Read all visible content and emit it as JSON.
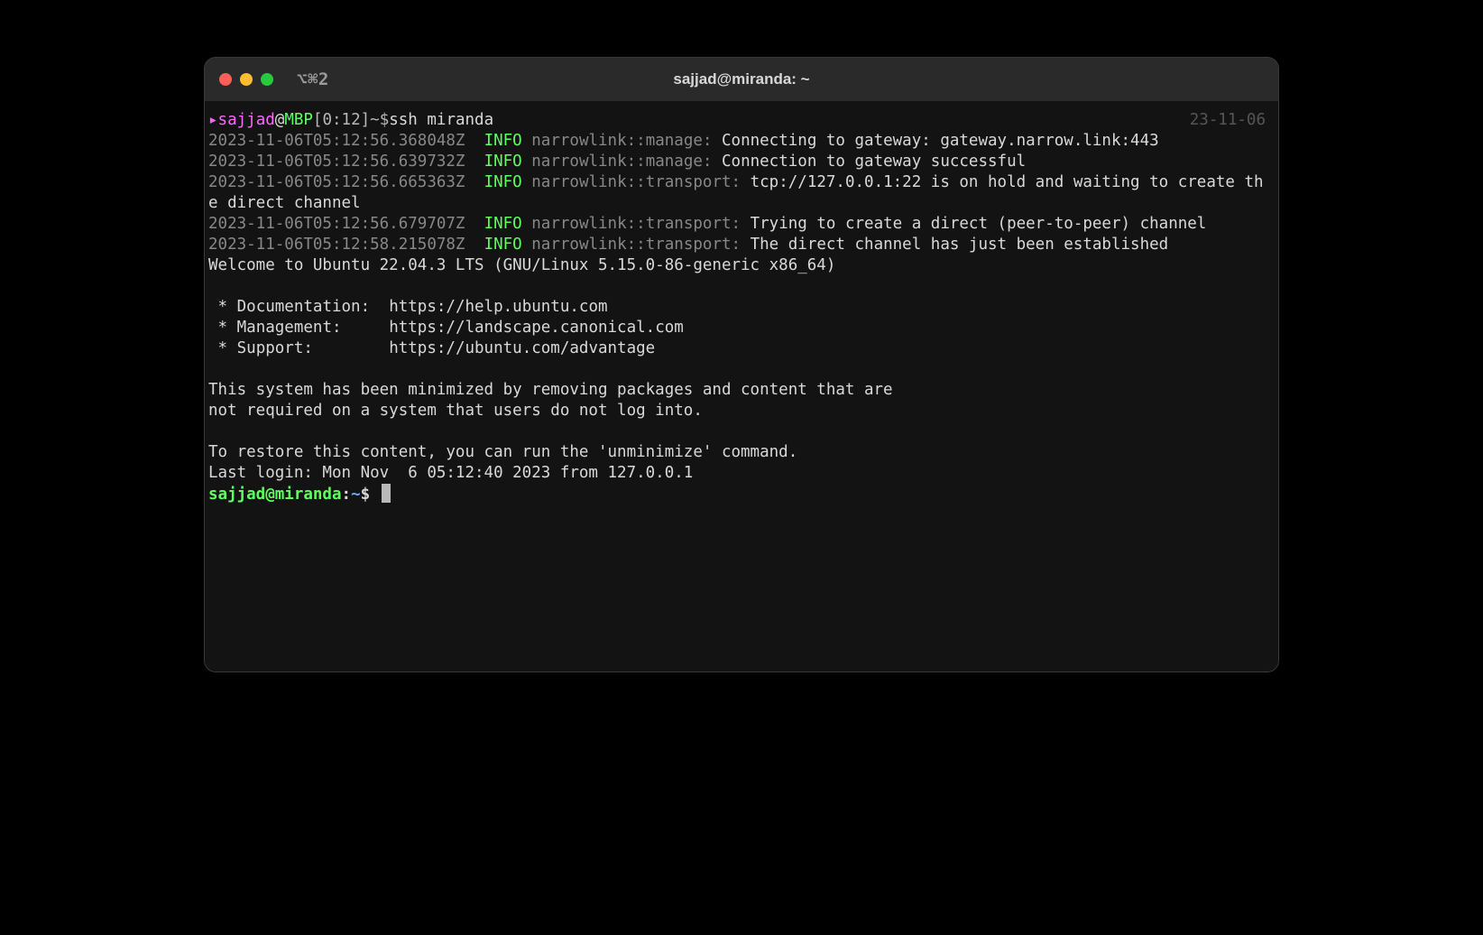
{
  "window": {
    "title": "sajjad@miranda: ~",
    "session_hint": "⌥⌘2"
  },
  "prompt1": {
    "caret": "▸",
    "user": "sajjad",
    "at": "@",
    "host": "MBP",
    "meta": "[0:12]",
    "path": "~",
    "dollar": "$",
    "command": "ssh miranda",
    "date_right": "23-11-06"
  },
  "logs": [
    {
      "ts": "2023-11-06T05:12:56.368048Z",
      "level": "INFO",
      "module": "narrowlink::manage:",
      "msg": "Connecting to gateway: gateway.narrow.link:443"
    },
    {
      "ts": "2023-11-06T05:12:56.639732Z",
      "level": "INFO",
      "module": "narrowlink::manage:",
      "msg": "Connection to gateway successful"
    },
    {
      "ts": "2023-11-06T05:12:56.665363Z",
      "level": "INFO",
      "module": "narrowlink::transport:",
      "msg": "tcp://127.0.0.1:22 is on hold and waiting to create the direct channel"
    },
    {
      "ts": "2023-11-06T05:12:56.679707Z",
      "level": "INFO",
      "module": "narrowlink::transport:",
      "msg": "Trying to create a direct (peer-to-peer) channel"
    },
    {
      "ts": "2023-11-06T05:12:58.215078Z",
      "level": "INFO",
      "module": "narrowlink::transport:",
      "msg": "The direct channel has just been established"
    }
  ],
  "motd": {
    "welcome": "Welcome to Ubuntu 22.04.3 LTS (GNU/Linux 5.15.0-86-generic x86_64)",
    "blank1": "",
    "doc": " * Documentation:  https://help.ubuntu.com",
    "mgmt": " * Management:     https://landscape.canonical.com",
    "support": " * Support:        https://ubuntu.com/advantage",
    "blank2": "",
    "min1": "This system has been minimized by removing packages and content that are",
    "min2": "not required on a system that users do not log into.",
    "blank3": "",
    "restore": "To restore this content, you can run the 'unminimize' command.",
    "lastlogin": "Last login: Mon Nov  6 05:12:40 2023 from 127.0.0.1"
  },
  "prompt2": {
    "userhost": "sajjad@miranda",
    "sep": ":",
    "path": "~",
    "dollar": "$ "
  }
}
